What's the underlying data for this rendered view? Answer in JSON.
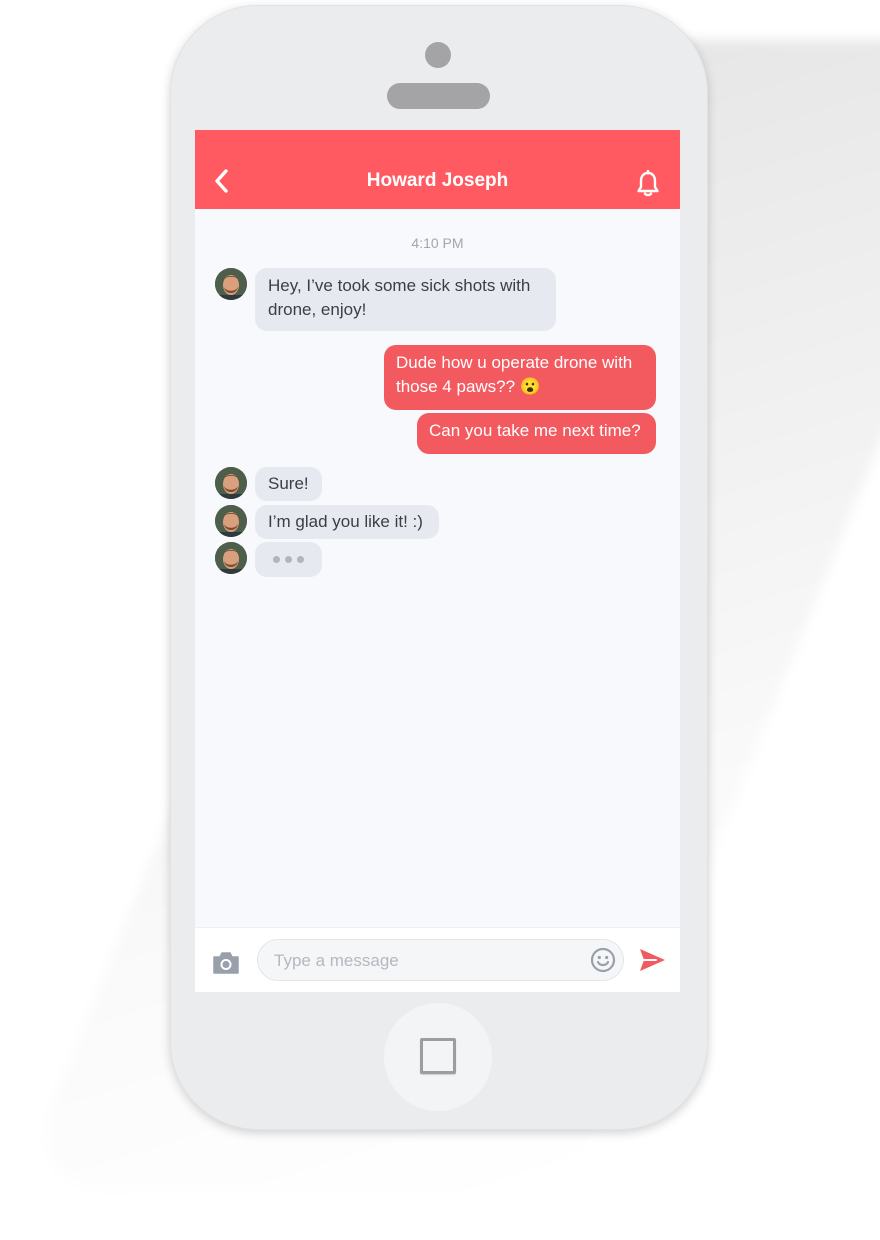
{
  "header": {
    "title": "Howard Joseph",
    "back_icon": "chevron-left-icon",
    "bell_icon": "bell-icon",
    "color": "#ff5a61"
  },
  "chat": {
    "timestamp": "4:10 PM",
    "messages": [
      {
        "from": "contact",
        "text": "Hey, I’ve took some sick shots with drone, enjoy!"
      },
      {
        "from": "me",
        "text": "Dude how u operate drone with those 4 paws?? 😮"
      },
      {
        "from": "me",
        "text": "Can you take me next time?"
      },
      {
        "from": "contact",
        "text": "Sure!"
      },
      {
        "from": "contact",
        "text": "I’m glad you like it! :)"
      },
      {
        "from": "contact",
        "typing": true
      }
    ]
  },
  "composer": {
    "placeholder": "Type a message",
    "camera_icon": "camera-icon",
    "emoji_icon": "smiley-icon",
    "send_icon": "send-icon",
    "send_color": "#f25a60"
  },
  "colors": {
    "incoming_bubble": "#e6eaf0",
    "outgoing_bubble": "#f25a60",
    "screen_bg": "#f8f9fc"
  }
}
